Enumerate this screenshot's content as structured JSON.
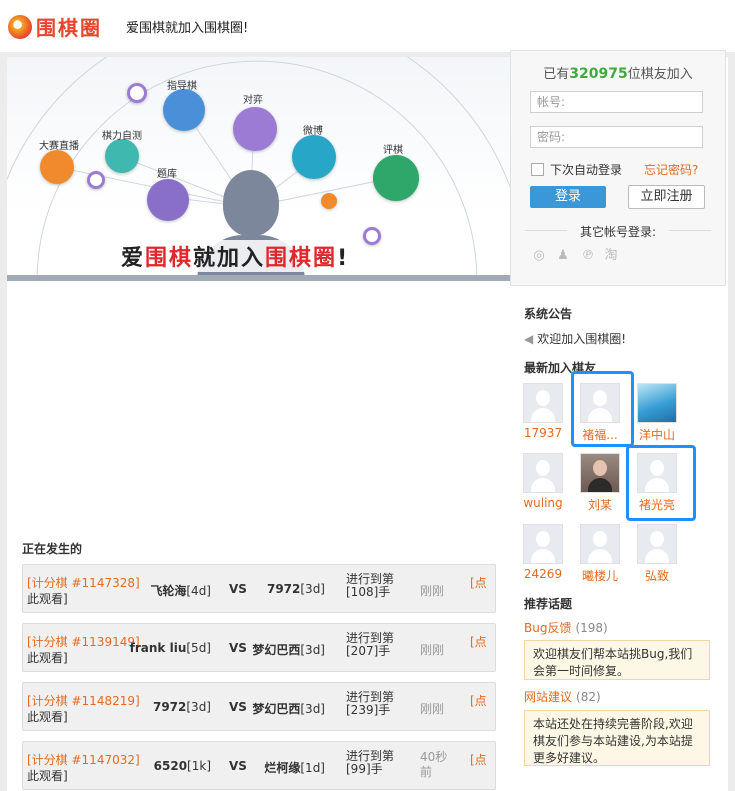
{
  "header": {
    "logo_text": "围棋圈",
    "slogan": "爱围棋就加入围棋圈!"
  },
  "banner": {
    "labels": [
      "大赛直播",
      "棋力自测",
      "指导棋",
      "题库",
      "对弈",
      "微博",
      "评棋"
    ],
    "slogan_parts": [
      "爱",
      "围棋",
      "就加入",
      "围棋圈",
      "!"
    ]
  },
  "login": {
    "joined_prefix": "已有",
    "joined_count": "320975",
    "joined_suffix": "位棋友加入",
    "account_placeholder": "帐号:",
    "password_placeholder": "密码:",
    "remember_label": "下次自动登录",
    "forgot_label": "忘记密码?",
    "login_button": "登录",
    "register_button": "立即注册",
    "other_login": "其它帐号登录:",
    "social_icons": [
      "weibo-icon",
      "qq-icon",
      "p-icon",
      "tao-icon"
    ]
  },
  "sidebar": {
    "announcement_title": "系统公告",
    "announcement_text": "欢迎加入围棋圈!",
    "new_members_title": "最新加入棋友",
    "members": [
      "17937",
      "褚褔...",
      "洋中山",
      "wuling",
      "刘某",
      "褚光亮",
      "24269",
      "曦楼儿",
      "弘致"
    ],
    "topics_title": "推荐话题",
    "topics": [
      {
        "title": "Bug反馈",
        "count": "(198)",
        "text": "欢迎棋友们帮本站挑Bug,我们会第一时间修复。"
      },
      {
        "title": "网站建议",
        "count": "(82)",
        "text": "本站还处在持续完善阶段,欢迎棋友们参与本站建设,为本站提更多好建议。"
      }
    ]
  },
  "main": {
    "happening_title": "正在发生的",
    "vs_label": "VS",
    "watch_open": "[点",
    "watch_close": "此观看]",
    "games": [
      {
        "tag": "[计分棋 #1147328]",
        "p1_name": "飞轮海",
        "p1_rank": "[4d]",
        "p2_name": "7972",
        "p2_rank": "[3d]",
        "progress_line1": "进行到第",
        "progress_line2": "[108]手",
        "time": "刚刚"
      },
      {
        "tag": "[计分棋 #1139149]",
        "p1_name": "frank liu",
        "p1_rank": "[5d]",
        "p2_name": "梦幻巴西",
        "p2_rank": "[3d]",
        "progress_line1": "进行到第",
        "progress_line2": "[207]手",
        "time": "刚刚"
      },
      {
        "tag": "[计分棋 #1148219]",
        "p1_name": "7972",
        "p1_rank": "[3d]",
        "p2_name": "梦幻巴西",
        "p2_rank": "[3d]",
        "progress_line1": "进行到第",
        "progress_line2": "[239]手",
        "time": "刚刚"
      },
      {
        "tag": "[计分棋 #1147032]",
        "p1_name": "6520",
        "p1_rank": "[1k]",
        "p2_name": "烂柯缘",
        "p2_rank": "[1d]",
        "progress_line1": "进行到第",
        "progress_line2": "[99]手",
        "time": "40秒前"
      }
    ]
  }
}
